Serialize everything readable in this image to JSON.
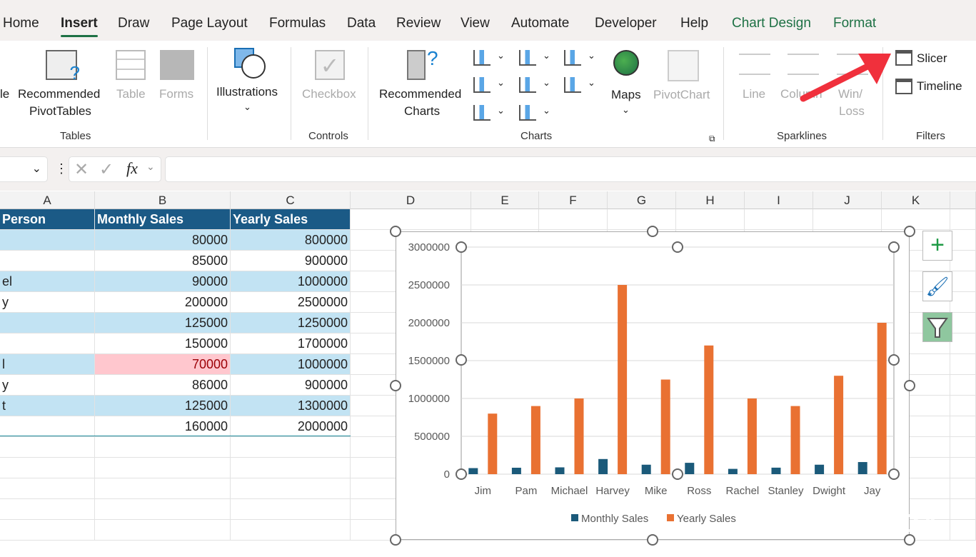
{
  "tabs": [
    "Home",
    "Insert",
    "Draw",
    "Page Layout",
    "Formulas",
    "Data",
    "Review",
    "View",
    "Automate",
    "Developer",
    "Help",
    "Chart Design",
    "Format"
  ],
  "ribbon": {
    "tables": {
      "cut_label": "le",
      "recommended_pivot": [
        "Recommended",
        "PivotTables"
      ],
      "table": "Table",
      "forms": "Forms",
      "group": "Tables"
    },
    "illustrations": "Illustrations",
    "controls": {
      "checkbox": "Checkbox",
      "group": "Controls"
    },
    "charts": {
      "recommended": [
        "Recommended",
        "Charts"
      ],
      "maps": "Maps",
      "pivotchart": "PivotChart",
      "group": "Charts"
    },
    "sparklines": {
      "line": "Line",
      "column": "Column",
      "winloss": [
        "Win/",
        "Loss"
      ],
      "group": "Sparklines"
    },
    "filters": {
      "slicer": "Slicer",
      "timeline": "Timeline",
      "group": "Filters"
    }
  },
  "formula_bar": {
    "fx": "fx",
    "value": ""
  },
  "columns": [
    "A",
    "B",
    "C",
    "D",
    "E",
    "F",
    "G",
    "H",
    "I",
    "J",
    "K"
  ],
  "table": {
    "headers": [
      "Person",
      "Monthly Sales",
      "Yearly Sales"
    ],
    "rows": [
      [
        "",
        "80000",
        "800000"
      ],
      [
        "",
        "85000",
        "900000"
      ],
      [
        "el",
        "90000",
        "1000000"
      ],
      [
        "y",
        "200000",
        "2500000"
      ],
      [
        "",
        "125000",
        "1250000"
      ],
      [
        "",
        "150000",
        "1700000"
      ],
      [
        "l",
        "70000",
        "1000000"
      ],
      [
        "y",
        "86000",
        "900000"
      ],
      [
        "t",
        "125000",
        "1300000"
      ],
      [
        "",
        "160000",
        "2000000"
      ]
    ],
    "highlight_color": "#ffc7ce",
    "highlight_text": "#9c0006"
  },
  "chart_data": {
    "type": "bar",
    "categories": [
      "Jim",
      "Pam",
      "Michael",
      "Harvey",
      "Mike",
      "Ross",
      "Rachel",
      "Stanley",
      "Dwight",
      "Jay"
    ],
    "series": [
      {
        "name": "Monthly Sales",
        "color": "#1b5a7a",
        "values": [
          80000,
          85000,
          90000,
          200000,
          125000,
          150000,
          70000,
          86000,
          125000,
          160000
        ]
      },
      {
        "name": "Yearly Sales",
        "color": "#e97132",
        "values": [
          800000,
          900000,
          1000000,
          2500000,
          1250000,
          1700000,
          1000000,
          900000,
          1300000,
          2000000
        ]
      }
    ],
    "ylim": [
      0,
      3000000
    ],
    "yticks": [
      "0",
      "500000",
      "1000000",
      "1500000",
      "2000000",
      "2500000",
      "3000000"
    ],
    "grid": true,
    "legend": "bottom"
  },
  "watermark": "XDA"
}
